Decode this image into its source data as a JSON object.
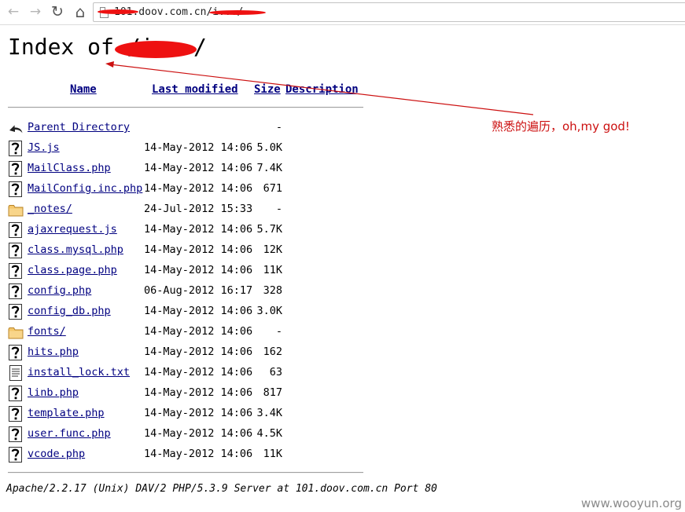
{
  "browser": {
    "url_text": "101.doov.com.cn/i.../",
    "back_label": "←",
    "forward_label": "→",
    "reload_label": "↻",
    "home_label": "⌂"
  },
  "page": {
    "title": "Index of /i.../",
    "columns": {
      "name": "Name",
      "last_modified": "Last modified",
      "size": "Size",
      "description": "Description"
    },
    "rows": [
      {
        "icon": "back-icon",
        "name": "Parent Directory",
        "date": "",
        "size": "-"
      },
      {
        "icon": "unknown-icon",
        "name": "JS.js",
        "date": "14-May-2012 14:06",
        "size": "5.0K"
      },
      {
        "icon": "unknown-icon",
        "name": "MailClass.php",
        "date": "14-May-2012 14:06",
        "size": "7.4K"
      },
      {
        "icon": "unknown-icon",
        "name": "MailConfig.inc.php",
        "date": "14-May-2012 14:06",
        "size": "671"
      },
      {
        "icon": "folder-icon",
        "name": "_notes/",
        "date": "24-Jul-2012 15:33",
        "size": "-"
      },
      {
        "icon": "unknown-icon",
        "name": "ajaxrequest.js",
        "date": "14-May-2012 14:06",
        "size": "5.7K"
      },
      {
        "icon": "unknown-icon",
        "name": "class.mysql.php",
        "date": "14-May-2012 14:06",
        "size": "12K"
      },
      {
        "icon": "unknown-icon",
        "name": "class.page.php",
        "date": "14-May-2012 14:06",
        "size": "11K"
      },
      {
        "icon": "unknown-icon",
        "name": "config.php",
        "date": "06-Aug-2012 16:17",
        "size": "328"
      },
      {
        "icon": "unknown-icon",
        "name": "config_db.php",
        "date": "14-May-2012 14:06",
        "size": "3.0K"
      },
      {
        "icon": "folder-icon",
        "name": "fonts/",
        "date": "14-May-2012 14:06",
        "size": "-"
      },
      {
        "icon": "unknown-icon",
        "name": "hits.php",
        "date": "14-May-2012 14:06",
        "size": "162"
      },
      {
        "icon": "text-icon",
        "name": "install_lock.txt",
        "date": "14-May-2012 14:06",
        "size": "63"
      },
      {
        "icon": "unknown-icon",
        "name": "linb.php",
        "date": "14-May-2012 14:06",
        "size": "817"
      },
      {
        "icon": "unknown-icon",
        "name": "template.php",
        "date": "14-May-2012 14:06",
        "size": "3.4K"
      },
      {
        "icon": "unknown-icon",
        "name": "user.func.php",
        "date": "14-May-2012 14:06",
        "size": "4.5K"
      },
      {
        "icon": "unknown-icon",
        "name": "vcode.php",
        "date": "14-May-2012 14:06",
        "size": "11K"
      }
    ],
    "footer": "Apache/2.2.17 (Unix) DAV/2 PHP/5.3.9 Server at 101.doov.com.cn Port 80"
  },
  "annotation": {
    "text": "熟悉的遍历，oh,my god!",
    "color": "#cc1010"
  },
  "watermark": "www.wooyun.org",
  "colors": {
    "link": "#000080",
    "redaction": "#ee1111"
  }
}
